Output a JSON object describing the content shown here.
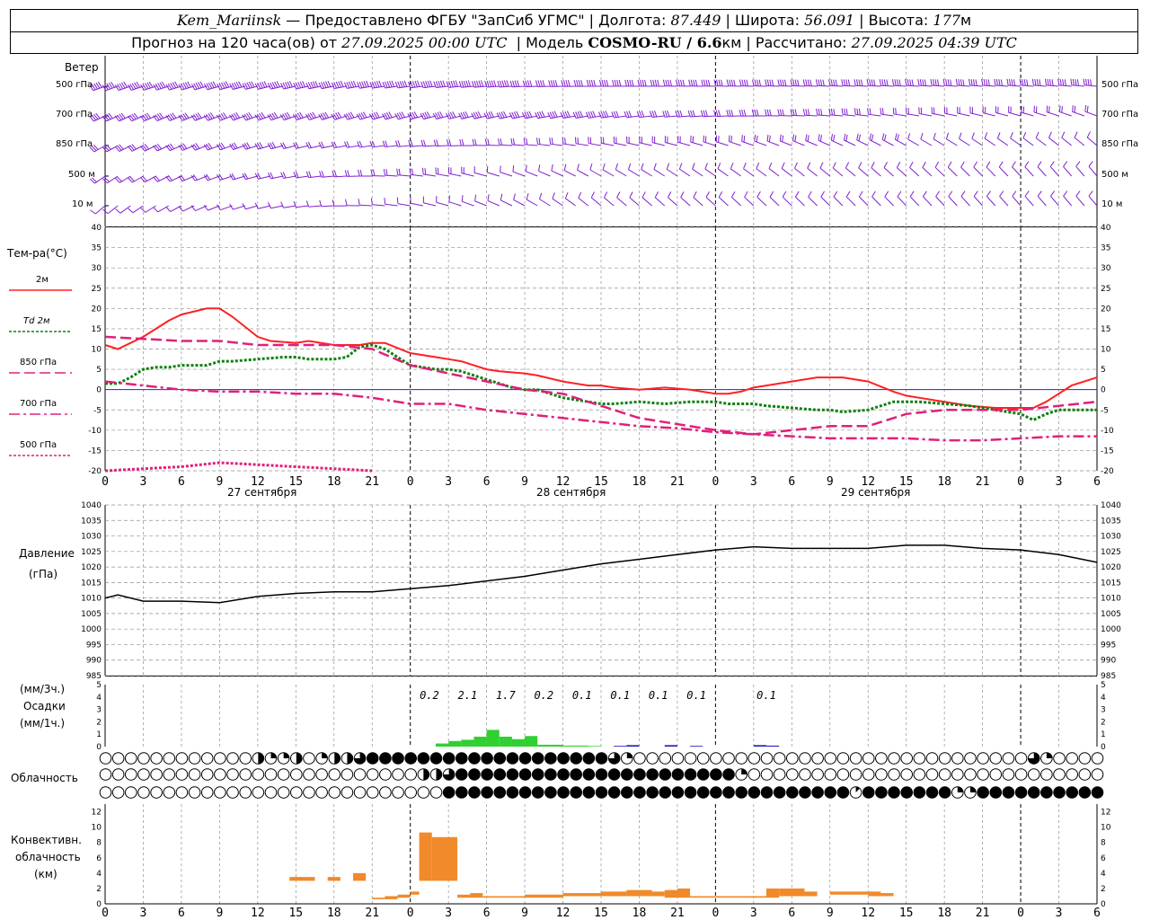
{
  "header": {
    "station": "Kem_Mariinsk",
    "provider": "— Предоставлено ФГБУ \"ЗапСиб УГМС\"",
    "lon_label": "Долгота:",
    "lon": "87.449",
    "lat_label": "Широта:",
    "lat": "56.091",
    "alt_label": "Высота:",
    "alt": "177",
    "alt_unit": "м",
    "forecast_prefix": "Прогноз на 120 часа(ов) от",
    "forecast_start": "27.09.2025 00:00 UTC",
    "model_label": "Модель",
    "model": "COSMO-RU / 6.6",
    "model_unit": "км",
    "computed_label": "Рассчитано:",
    "computed": "27.09.2025 04:39 UTC"
  },
  "labels": {
    "wind_title": "Ветер",
    "wind_levels": [
      "500 гПа",
      "700 гПа",
      "850 гПа",
      "500 м",
      "10 м"
    ],
    "temp_title": "Тем-ра(°С)",
    "temp_legend": [
      {
        "label": "2м",
        "color": "#ff2020",
        "dash": ""
      },
      {
        "label": "Td 2м",
        "color": "#108010",
        "dash": "3,2"
      },
      {
        "label": "850 гПа",
        "color": "#e0207a",
        "dash": "12,5"
      },
      {
        "label": "700 гПа",
        "color": "#e0207a",
        "dash": "12,4,3,4"
      },
      {
        "label": "500 гПа",
        "color": "#e0207a",
        "dash": "3,2"
      }
    ],
    "pressure_title": "Давление",
    "pressure_unit": "(гПа)",
    "precip_unit_top": "(мм/3ч.)",
    "precip_title": "Осадки",
    "precip_unit_bottom": "(мм/1ч.)",
    "cloud_title": "Облачность",
    "conv_title_1": "Конвективн.",
    "conv_title_2": "облачность",
    "conv_unit": "(км)",
    "day_labels": [
      "27 сентября",
      "28 сентября",
      "29 сентября"
    ],
    "hour_ticks": [
      "0",
      "3",
      "6",
      "9",
      "12",
      "15",
      "18",
      "21",
      "0",
      "3",
      "6",
      "9",
      "12",
      "15",
      "18",
      "21",
      "0",
      "3",
      "6",
      "9",
      "12",
      "15",
      "18",
      "21",
      "0",
      "3",
      "6"
    ]
  },
  "chart_data": [
    {
      "type": "line",
      "title": "Тем-ра(°С)",
      "x_unit": "hours from 27.09.2025 00:00 UTC",
      "xlim": [
        0,
        78
      ],
      "ylim": [
        -20,
        40
      ],
      "series": [
        {
          "name": "2м",
          "color": "#ff2020",
          "x": [
            0,
            1,
            3,
            5,
            6,
            8,
            9,
            10,
            12,
            13,
            15,
            16,
            18,
            20,
            21,
            22,
            24,
            26,
            27,
            28,
            30,
            31,
            33,
            34,
            36,
            38,
            39,
            40,
            42,
            44,
            46,
            48,
            49,
            50,
            51,
            52,
            54,
            56,
            57,
            58,
            60,
            62,
            63,
            64,
            66,
            68,
            70,
            72,
            73,
            74,
            75,
            76,
            78
          ],
          "y": [
            11,
            10,
            13,
            17,
            18.5,
            20,
            20,
            18,
            13,
            12,
            11.5,
            12,
            11,
            11,
            11.5,
            11.5,
            9,
            8,
            7.5,
            7,
            5,
            4.5,
            4,
            3.5,
            2,
            1,
            1,
            0.5,
            0,
            0.5,
            0,
            -1,
            -1,
            -0.5,
            0.5,
            1,
            2,
            3,
            3,
            3,
            2,
            -0.5,
            -1.5,
            -2,
            -3,
            -4,
            -4.5,
            -4.5,
            -4.5,
            -3,
            -1,
            1,
            3
          ]
        },
        {
          "name": "Td 2м",
          "color": "#108010",
          "x": [
            0,
            1,
            2,
            3,
            4,
            5,
            6,
            8,
            9,
            10,
            12,
            14,
            15,
            16,
            18,
            19,
            20,
            21,
            22,
            23,
            24,
            26,
            27,
            28,
            30,
            32,
            33,
            34,
            36,
            38,
            39,
            40,
            42,
            44,
            46,
            48,
            49,
            50,
            51,
            52,
            54,
            56,
            57,
            58,
            60,
            62,
            63,
            64,
            66,
            68,
            70,
            72,
            73,
            74,
            75,
            76,
            78
          ],
          "y": [
            1.5,
            1.5,
            3,
            5,
            5.5,
            5.5,
            6,
            6,
            7,
            7,
            7.5,
            8,
            8,
            7.5,
            7.5,
            8,
            10.5,
            11,
            10,
            8,
            6,
            5,
            5,
            4.5,
            2.5,
            0.5,
            0,
            0,
            -2,
            -3,
            -3.5,
            -3.5,
            -3,
            -3.5,
            -3,
            -3,
            -3.5,
            -3.5,
            -3.5,
            -4,
            -4.5,
            -5,
            -5,
            -5.5,
            -5,
            -3,
            -3,
            -3,
            -3.5,
            -4,
            -5,
            -6,
            -7.5,
            -6,
            -5,
            -5,
            -5
          ]
        },
        {
          "name": "850 гПа",
          "color": "#e0207a",
          "x": [
            0,
            3,
            6,
            9,
            12,
            15,
            18,
            21,
            24,
            27,
            30,
            33,
            36,
            39,
            42,
            45,
            48,
            51,
            54,
            57,
            60,
            63,
            66,
            69,
            72,
            75,
            78
          ],
          "y": [
            13,
            12.5,
            12,
            12,
            11,
            11,
            11,
            10,
            6,
            4,
            2,
            0,
            -1,
            -4,
            -7,
            -8.5,
            -10,
            -11,
            -10,
            -9,
            -9,
            -6,
            -5,
            -5,
            -5,
            -4,
            -3
          ]
        },
        {
          "name": "700 гПа",
          "color": "#e0207a",
          "x": [
            0,
            3,
            6,
            9,
            12,
            15,
            18,
            21,
            24,
            27,
            30,
            33,
            36,
            39,
            42,
            45,
            48,
            51,
            54,
            57,
            60,
            63,
            66,
            69,
            72,
            75,
            78
          ],
          "y": [
            2,
            1,
            0,
            -0.5,
            -0.5,
            -1,
            -1,
            -2,
            -3.5,
            -3.5,
            -5,
            -6,
            -7,
            -8,
            -9,
            -9.5,
            -10.5,
            -11,
            -11.5,
            -12,
            -12,
            -12,
            -12.5,
            -12.5,
            -12,
            -11.5,
            -11.5
          ]
        },
        {
          "name": "500 гПа",
          "color": "#e0207a",
          "x": [
            0,
            3,
            6,
            9,
            12,
            15,
            18,
            21
          ],
          "y": [
            -20,
            -19.5,
            -19,
            -18,
            -18.5,
            -19,
            -19.5,
            -20
          ]
        }
      ]
    },
    {
      "type": "line",
      "title": "Давление",
      "ylabel": "(гПа)",
      "xlim": [
        0,
        78
      ],
      "ylim": [
        985,
        1040
      ],
      "series": [
        {
          "name": "Давление",
          "color": "#000000",
          "x": [
            0,
            1,
            3,
            6,
            9,
            12,
            15,
            18,
            21,
            24,
            27,
            30,
            33,
            36,
            39,
            42,
            45,
            48,
            51,
            54,
            57,
            60,
            63,
            66,
            69,
            72,
            75,
            78
          ],
          "y": [
            1010,
            1011,
            1009,
            1009,
            1008.5,
            1010.5,
            1011.5,
            1012,
            1012,
            1013,
            1014,
            1015.5,
            1017,
            1019,
            1021,
            1022.5,
            1024,
            1025.5,
            1026.5,
            1026,
            1026,
            1026,
            1027,
            1027,
            1026,
            1025.5,
            1024,
            1021.5
          ]
        }
      ]
    },
    {
      "type": "bar",
      "title": "Осадки",
      "ylabel": "(мм/1ч.)",
      "xlim": [
        0,
        78
      ],
      "ylim": [
        0,
        5
      ],
      "bars": [
        {
          "x": 26,
          "w": 1,
          "v": 0.25,
          "c": "#30d030"
        },
        {
          "x": 27,
          "w": 1,
          "v": 0.45,
          "c": "#30d030"
        },
        {
          "x": 28,
          "w": 1,
          "v": 0.55,
          "c": "#30d030"
        },
        {
          "x": 29,
          "w": 1,
          "v": 0.8,
          "c": "#30d030"
        },
        {
          "x": 30,
          "w": 1,
          "v": 1.35,
          "c": "#30d030"
        },
        {
          "x": 31,
          "w": 1,
          "v": 0.8,
          "c": "#30d030"
        },
        {
          "x": 32,
          "w": 1,
          "v": 0.6,
          "c": "#30d030"
        },
        {
          "x": 33,
          "w": 1,
          "v": 0.85,
          "c": "#30d030"
        },
        {
          "x": 34,
          "w": 1,
          "v": 0.15,
          "c": "#30d030"
        },
        {
          "x": 35,
          "w": 1,
          "v": 0.15,
          "c": "#30d030"
        },
        {
          "x": 36,
          "w": 2,
          "v": 0.08,
          "c": "#30d030"
        },
        {
          "x": 38,
          "w": 1,
          "v": 0.05,
          "c": "#30d030"
        },
        {
          "x": 40,
          "w": 1,
          "v": 0.06,
          "c": "#2020c0"
        },
        {
          "x": 41,
          "w": 1,
          "v": 0.12,
          "c": "#2020c0"
        },
        {
          "x": 44,
          "w": 1,
          "v": 0.12,
          "c": "#2020c0"
        },
        {
          "x": 46,
          "w": 1,
          "v": 0.06,
          "c": "#2020c0"
        },
        {
          "x": 51,
          "w": 1,
          "v": 0.12,
          "c": "#2020c0"
        },
        {
          "x": 52,
          "w": 1,
          "v": 0.08,
          "c": "#2020c0"
        }
      ],
      "totals_3h": [
        {
          "x": 25.5,
          "v": "0.2"
        },
        {
          "x": 28.5,
          "v": "2.1"
        },
        {
          "x": 31.5,
          "v": "1.7"
        },
        {
          "x": 34.5,
          "v": "0.2"
        },
        {
          "x": 37.5,
          "v": "0.1"
        },
        {
          "x": 40.5,
          "v": "0.1"
        },
        {
          "x": 43.5,
          "v": "0.1"
        },
        {
          "x": 46.5,
          "v": "0.1"
        },
        {
          "x": 52,
          "v": "0.1"
        }
      ]
    },
    {
      "type": "table",
      "title": "Облачность",
      "rows": [
        {
          "levels": "top",
          "x_step": 1,
          "cover_eighths": "000000000000422402446888888888888888888862000000000000000000000000000000062000000"
        },
        {
          "levels": "middle",
          "cover_eighths": "000000000000000000000000044688888888888888888888882000000000000000000000000000000"
        },
        {
          "levels": "bottom",
          "cover_eighths": "000000000000000000000000000888888888888888888888888888888881888888822888888888888883000000000000000000"
        }
      ]
    },
    {
      "type": "bar",
      "title": "Конвективн. облачность",
      "ylabel": "(км)",
      "xlim": [
        0,
        78
      ],
      "ylim": [
        0,
        13
      ],
      "color": "#f08a2a",
      "bars": [
        {
          "x0": 14.5,
          "x1": 16.5,
          "b": 3.0,
          "t": 3.5
        },
        {
          "x0": 17.5,
          "x1": 18.5,
          "b": 3.0,
          "t": 3.5
        },
        {
          "x0": 19.5,
          "x1": 20.5,
          "b": 3.0,
          "t": 4.0
        },
        {
          "x0": 21,
          "x1": 22,
          "b": 0.6,
          "t": 0.8
        },
        {
          "x0": 22,
          "x1": 23,
          "b": 0.6,
          "t": 1.0
        },
        {
          "x0": 23,
          "x1": 24,
          "b": 0.8,
          "t": 1.2
        },
        {
          "x0": 24,
          "x1": 24.7,
          "b": 1.2,
          "t": 1.6
        },
        {
          "x0": 24.7,
          "x1": 25.7,
          "b": 3.0,
          "t": 9.3
        },
        {
          "x0": 25.7,
          "x1": 27.7,
          "b": 3.0,
          "t": 8.7
        },
        {
          "x0": 27.7,
          "x1": 28.7,
          "b": 0.8,
          "t": 1.2
        },
        {
          "x0": 28.7,
          "x1": 29.7,
          "b": 0.8,
          "t": 1.4
        },
        {
          "x0": 29.7,
          "x1": 33,
          "b": 0.8,
          "t": 1.0
        },
        {
          "x0": 33,
          "x1": 36,
          "b": 0.8,
          "t": 1.2
        },
        {
          "x0": 36,
          "x1": 39,
          "b": 1.0,
          "t": 1.4
        },
        {
          "x0": 39,
          "x1": 41,
          "b": 1.0,
          "t": 1.6
        },
        {
          "x0": 41,
          "x1": 43,
          "b": 1.0,
          "t": 1.8
        },
        {
          "x0": 43,
          "x1": 44,
          "b": 1.0,
          "t": 1.6
        },
        {
          "x0": 44,
          "x1": 45,
          "b": 0.8,
          "t": 1.8
        },
        {
          "x0": 45,
          "x1": 46,
          "b": 0.8,
          "t": 2.0
        },
        {
          "x0": 46,
          "x1": 48,
          "b": 0.8,
          "t": 1.0
        },
        {
          "x0": 48,
          "x1": 52,
          "b": 0.8,
          "t": 1.0
        },
        {
          "x0": 52,
          "x1": 53,
          "b": 0.8,
          "t": 2.0
        },
        {
          "x0": 53,
          "x1": 55,
          "b": 1.0,
          "t": 2.0
        },
        {
          "x0": 55,
          "x1": 56,
          "b": 1.0,
          "t": 1.6
        },
        {
          "x0": 57,
          "x1": 60,
          "b": 1.2,
          "t": 1.6
        },
        {
          "x0": 60,
          "x1": 61,
          "b": 1.0,
          "t": 1.6
        },
        {
          "x0": 61,
          "x1": 62,
          "b": 1.0,
          "t": 1.4
        }
      ]
    },
    {
      "type": "scatter",
      "title": "Ветер",
      "levels": [
        "500 гПа",
        "700 гПа",
        "850 гПа",
        "500 м",
        "10 м"
      ],
      "color": "#8020d0",
      "note": "direction (deg, from) and speed (m/s) every hour",
      "segments": [
        {
          "level": "500 гПа",
          "from": 0,
          "to": 78,
          "dir": [
            250,
            270,
            275
          ],
          "spd": [
            25,
            22,
            18
          ]
        },
        {
          "level": "700 гПа",
          "from": 0,
          "to": 78,
          "dir": [
            245,
            260,
            290
          ],
          "spd": [
            20,
            18,
            8
          ]
        },
        {
          "level": "850 гПа",
          "from": 0,
          "to": 78,
          "dir": [
            240,
            280,
            310
          ],
          "spd": [
            14,
            10,
            6
          ]
        },
        {
          "level": "500 м",
          "from": 0,
          "to": 78,
          "dir": [
            235,
            300,
            320
          ],
          "spd": [
            12,
            6,
            6
          ]
        },
        {
          "level": "10 м",
          "from": 0,
          "to": 78,
          "dir": [
            230,
            310,
            320
          ],
          "spd": [
            6,
            3,
            3
          ]
        }
      ]
    }
  ],
  "colors": {
    "wind": "#8020d0",
    "t2m": "#ff2020",
    "td2m": "#108010",
    "upper": "#e0207a",
    "pressure": "#000000",
    "precip_rain": "#30d030",
    "precip_snow": "#2020c0",
    "convective": "#f08a2a",
    "grid": "#909090",
    "zero_line": "#2020ff"
  }
}
